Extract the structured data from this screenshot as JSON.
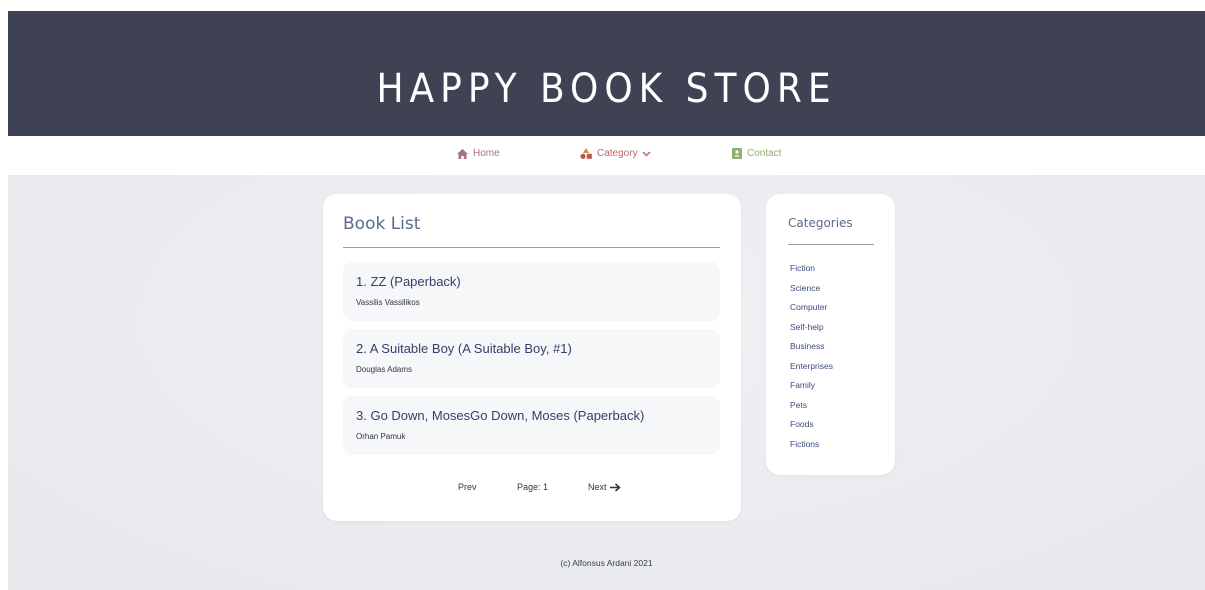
{
  "header": {
    "title": "HAPPY BOOK STORE"
  },
  "nav": {
    "home": "Home",
    "category": "Category",
    "contact": "Contact"
  },
  "book_list": {
    "title": "Book List",
    "items": [
      {
        "title": "1. ZZ (Paperback)",
        "author": "Vassilis Vassilikos"
      },
      {
        "title": "2. A Suitable Boy (A Suitable Boy, #1)",
        "author": "Douglas Adams"
      },
      {
        "title": "3. Go Down, MosesGo Down, Moses (Paperback)",
        "author": "Orhan Pamuk"
      }
    ],
    "pager": {
      "prev": "Prev",
      "page": "Page: 1",
      "next": "Next"
    }
  },
  "categories": {
    "title": "Categories",
    "items": [
      "Fiction",
      "Science",
      "Computer",
      "Self-help",
      "Business",
      "Enterprises",
      "Family",
      "Pets",
      "Foods",
      "Fictions"
    ]
  },
  "footer": {
    "text": "(c) Alfonsus Ardani 2021"
  },
  "colors": {
    "header_bg": "#3e4252",
    "accent": "#35406a",
    "home": "#a6708a",
    "category": "#b86a6a",
    "contact": "#8fb070"
  }
}
